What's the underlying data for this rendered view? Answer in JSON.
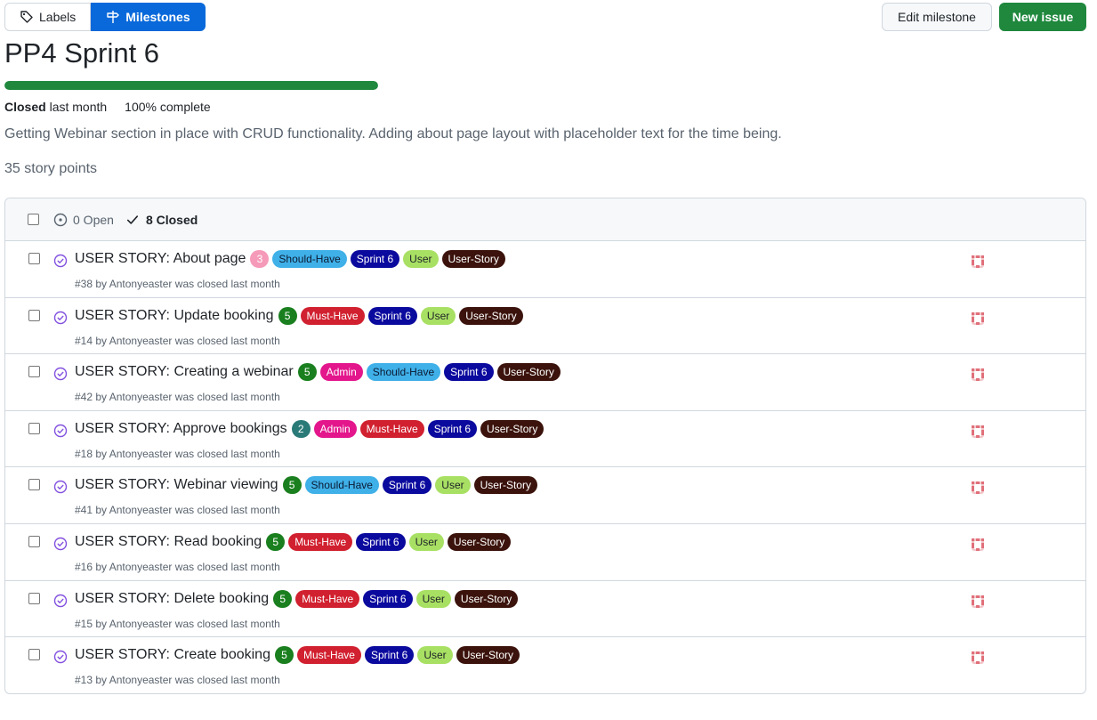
{
  "tabs": {
    "labels": "Labels",
    "milestones": "Milestones"
  },
  "buttons": {
    "edit": "Edit milestone",
    "new_issue": "New issue"
  },
  "milestone": {
    "title": "PP4 Sprint 6",
    "progress_percent": 100,
    "status": "Closed",
    "status_time": "last month",
    "complete_text": "100% complete",
    "description": "Getting Webinar section in place with CRUD functionality. Adding about page layout with placeholder text for the time being.",
    "story_points": "35 story points"
  },
  "list_header": {
    "open": "0 Open",
    "closed": "8 Closed"
  },
  "label_styles": {
    "Should-Have": {
      "bg": "#3fb0e8",
      "fg": "#0b1a33"
    },
    "Must-Have": {
      "bg": "#d1202f",
      "fg": "#ffffff"
    },
    "Sprint 6": {
      "bg": "#0b0a9e",
      "fg": "#ffffff"
    },
    "User": {
      "bg": "#a8e063",
      "fg": "#1f2328"
    },
    "User-Story": {
      "bg": "#3b130c",
      "fg": "#ffffff"
    },
    "Admin": {
      "bg": "#e3168c",
      "fg": "#ffffff"
    }
  },
  "issues": [
    {
      "title": "USER STORY: About page",
      "points": "3",
      "points_color": "#f59ab8",
      "labels": [
        "Should-Have",
        "Sprint 6",
        "User",
        "User-Story"
      ],
      "number": "#38",
      "author": "Antonyeaster",
      "closed_text": "was closed last month"
    },
    {
      "title": "USER STORY: Update booking",
      "points": "5",
      "points_color": "#1a7f1e",
      "labels": [
        "Must-Have",
        "Sprint 6",
        "User",
        "User-Story"
      ],
      "number": "#14",
      "author": "Antonyeaster",
      "closed_text": "was closed last month"
    },
    {
      "title": "USER STORY: Creating a webinar",
      "points": "5",
      "points_color": "#1a7f1e",
      "labels": [
        "Admin",
        "Should-Have",
        "Sprint 6",
        "User-Story"
      ],
      "number": "#42",
      "author": "Antonyeaster",
      "closed_text": "was closed last month"
    },
    {
      "title": "USER STORY: Approve bookings",
      "points": "2",
      "points_color": "#2a7a78",
      "labels": [
        "Admin",
        "Must-Have",
        "Sprint 6",
        "User-Story"
      ],
      "number": "#18",
      "author": "Antonyeaster",
      "closed_text": "was closed last month"
    },
    {
      "title": "USER STORY: Webinar viewing",
      "points": "5",
      "points_color": "#1a7f1e",
      "labels": [
        "Should-Have",
        "Sprint 6",
        "User",
        "User-Story"
      ],
      "number": "#41",
      "author": "Antonyeaster",
      "closed_text": "was closed last month"
    },
    {
      "title": "USER STORY: Read booking",
      "points": "5",
      "points_color": "#1a7f1e",
      "labels": [
        "Must-Have",
        "Sprint 6",
        "User",
        "User-Story"
      ],
      "number": "#16",
      "author": "Antonyeaster",
      "closed_text": "was closed last month"
    },
    {
      "title": "USER STORY: Delete booking",
      "points": "5",
      "points_color": "#1a7f1e",
      "labels": [
        "Must-Have",
        "Sprint 6",
        "User",
        "User-Story"
      ],
      "number": "#15",
      "author": "Antonyeaster",
      "closed_text": "was closed last month"
    },
    {
      "title": "USER STORY: Create booking",
      "points": "5",
      "points_color": "#1a7f1e",
      "labels": [
        "Must-Have",
        "Sprint 6",
        "User",
        "User-Story"
      ],
      "number": "#13",
      "author": "Antonyeaster",
      "closed_text": "was closed last month"
    }
  ]
}
